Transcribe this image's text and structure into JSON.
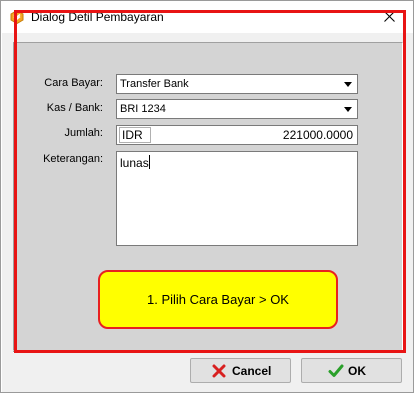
{
  "window": {
    "title": "Dialog Detil Pembayaran",
    "close_label": "×"
  },
  "form": {
    "payment_method_label": "Cara Bayar:",
    "payment_method_value": "Transfer Bank",
    "cash_bank_label": "Kas / Bank:",
    "cash_bank_value": "BRI 1234",
    "amount_label": "Jumlah:",
    "currency": "IDR",
    "amount_value": "221000.0000",
    "notes_label": "Keterangan:",
    "notes_value": "lunas"
  },
  "callout": {
    "text": "1. Pilih Cara Bayar > OK"
  },
  "buttons": {
    "cancel_label": "Cancel",
    "ok_label": "OK"
  },
  "colors": {
    "highlight_border": "#e81414",
    "callout_fill": "#ffff00",
    "cancel_icon": "#d82020",
    "ok_icon": "#2aa02a"
  },
  "icons": {
    "app": "app-logo-icon",
    "close": "close-icon",
    "cancel": "x-mark-icon",
    "ok": "checkmark-icon"
  }
}
